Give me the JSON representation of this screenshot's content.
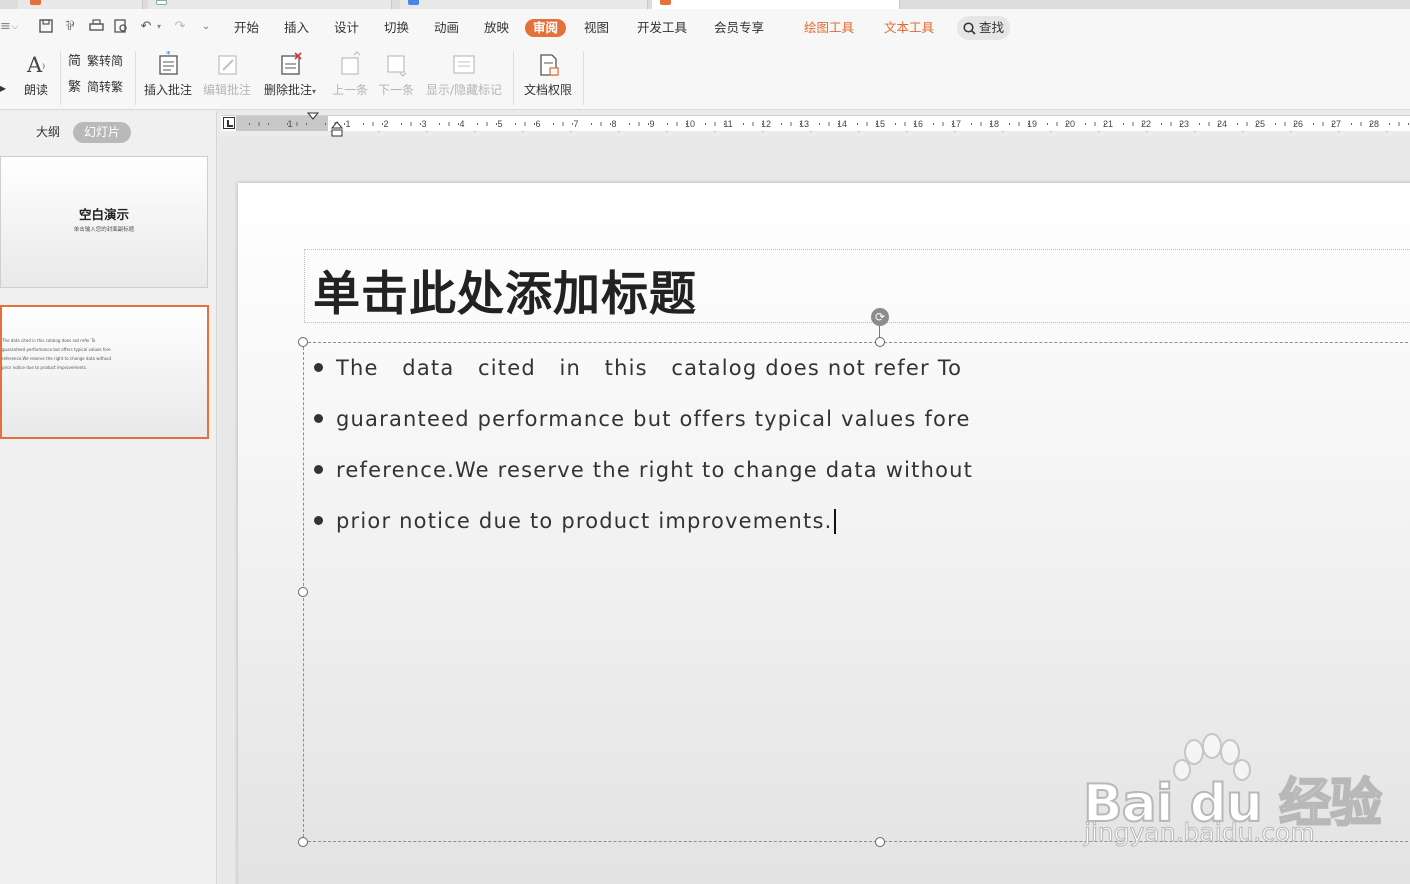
{
  "menu": {
    "items": [
      "开始",
      "插入",
      "设计",
      "切换",
      "动画",
      "放映",
      "审阅",
      "视图",
      "开发工具",
      "会员专享"
    ],
    "active": "审阅",
    "context_tabs": [
      "绘图工具",
      "文本工具"
    ],
    "search_label": "查找"
  },
  "ribbon": {
    "read_aloud": "朗读",
    "trad_to_simp": "繁转简",
    "simp_to_trad": "简转繁",
    "insert_comment": "插入批注",
    "edit_comment": "编辑批注",
    "delete_comment": "删除批注",
    "prev": "上一条",
    "next": "下一条",
    "show_hide_markup": "显示/隐藏标记",
    "doc_permission": "文档权限"
  },
  "left_panel": {
    "tab_outline": "大纲",
    "tab_slides": "幻灯片",
    "thumb1_title": "空白演示",
    "thumb1_subtitle": "单击输入您的封面副标题",
    "thumb2_lines": [
      "The data cited in this catalog does not refer To",
      "guaranteed performance but offers typical values fore",
      "reference.We reserve the right to change data without",
      "prior notice due to product improvements."
    ]
  },
  "ruler": {
    "ticks": [
      "1",
      "1",
      "2",
      "3",
      "4",
      "5",
      "6",
      "7",
      "8",
      "9",
      "10",
      "11",
      "12",
      "13",
      "14",
      "15",
      "16",
      "17",
      "18",
      "19",
      "20",
      "21",
      "22",
      "23",
      "24",
      "25",
      "26",
      "27",
      "28",
      "2"
    ]
  },
  "slide": {
    "title": "单击此处添加标题",
    "bullets": [
      "The   data   cited   in   this   catalog does not refer To",
      "guaranteed performance but offers typical values fore",
      "reference.We reserve the right to change data without",
      "prior notice due to product improvements."
    ]
  },
  "watermark": {
    "brand": "Bai du 经验",
    "url": "jingyan.baidu.com"
  },
  "colors": {
    "accent": "#e4713a",
    "context_tab": "#e36c2c"
  }
}
